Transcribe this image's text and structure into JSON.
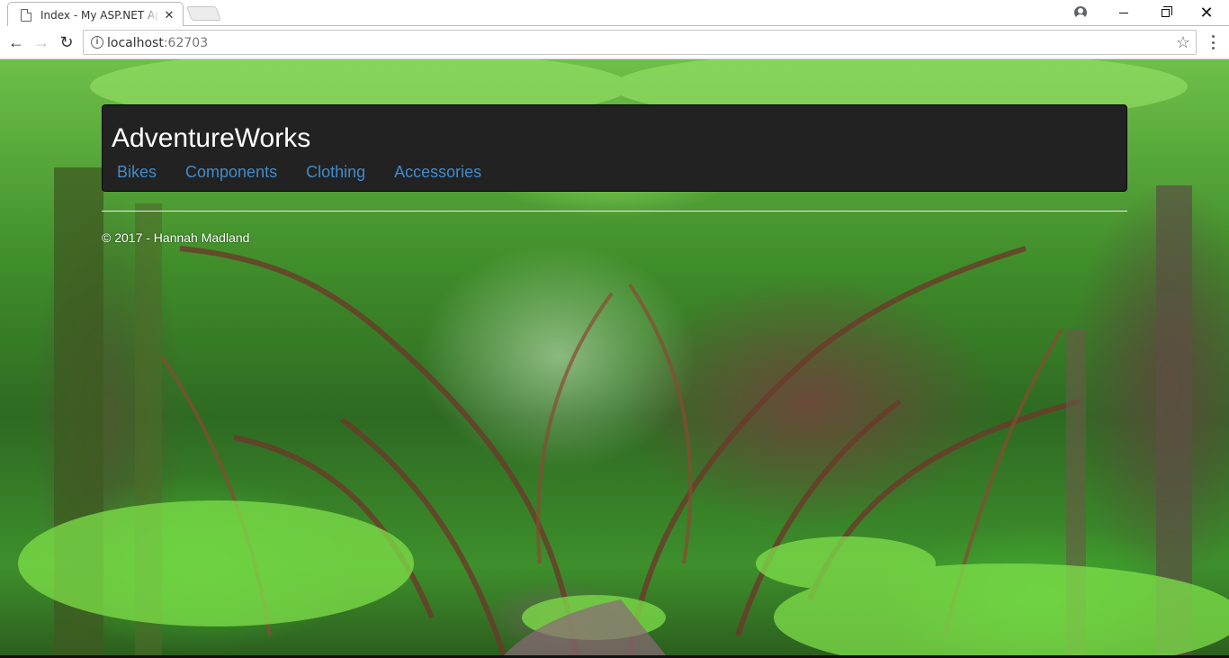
{
  "browser": {
    "tab_title": "Index - My ASP.NET Application",
    "tab_close": "✕",
    "url_host": "localhost",
    "url_port": ":62703"
  },
  "site": {
    "brand": "AdventureWorks",
    "nav": [
      "Bikes",
      "Components",
      "Clothing",
      "Accessories"
    ],
    "footer": "© 2017 - Hannah Madland"
  },
  "colors": {
    "navbar_bg": "#222222",
    "link": "#428bca",
    "brand_text": "#ffffff"
  },
  "icons": {
    "tab": "page-icon",
    "account": "account-icon",
    "back": "back-arrow-icon",
    "forward": "forward-arrow-icon",
    "reload": "reload-icon",
    "info": "info-icon",
    "bookmark": "star-icon",
    "menu": "kebab-menu-icon"
  }
}
